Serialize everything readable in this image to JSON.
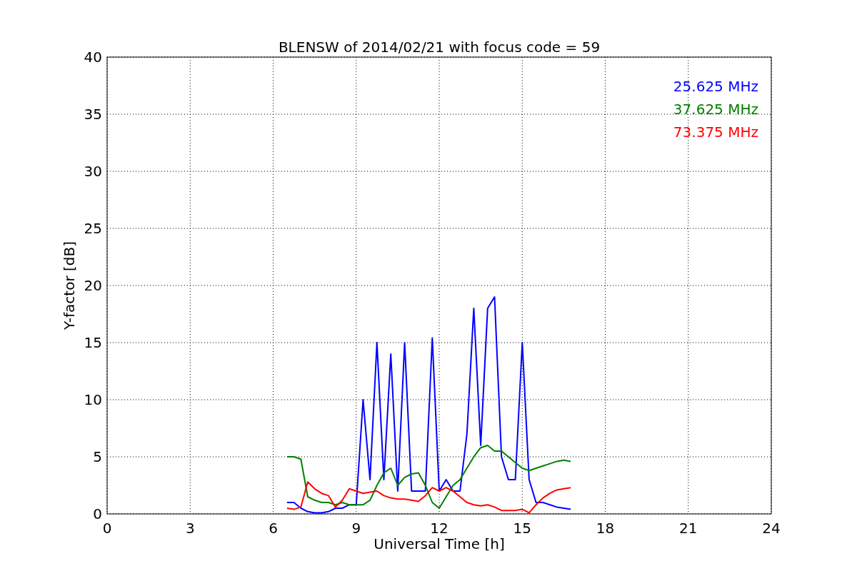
{
  "figure": {
    "chart_data": {
      "type": "line",
      "title": "BLENSW of 2014/02/21 with focus code = 59",
      "xlabel": "Universal Time [h]",
      "ylabel": "Y-factor [dB]",
      "x": [
        6.5,
        6.75,
        7,
        7.25,
        7.5,
        7.75,
        8,
        8.25,
        8.5,
        8.75,
        9,
        9.25,
        9.5,
        9.75,
        10,
        10.25,
        10.5,
        10.75,
        11,
        11.25,
        11.5,
        11.75,
        12,
        12.25,
        12.5,
        12.75,
        13,
        13.25,
        13.5,
        13.75,
        14,
        14.25,
        14.5,
        14.75,
        15,
        15.25,
        15.5,
        15.75,
        16,
        16.25,
        16.5,
        16.75
      ],
      "series": [
        {
          "name": "25.625 MHz",
          "color": "#0000ff",
          "values": [
            1,
            1,
            0.5,
            0.2,
            0.1,
            0.1,
            0.2,
            0.5,
            0.5,
            0.8,
            0.8,
            10,
            3,
            15,
            3,
            14,
            2,
            15,
            2,
            2,
            2,
            15.4,
            2,
            3,
            2,
            2,
            7,
            18,
            6,
            18,
            19,
            5,
            3,
            3,
            15,
            3,
            1,
            1,
            0.8,
            0.6,
            0.5,
            0.4
          ]
        },
        {
          "name": "37.625 MHz",
          "color": "#008000",
          "values": [
            5,
            5,
            4.8,
            1.5,
            1.2,
            1,
            1,
            0.8,
            1,
            0.8,
            0.8,
            0.8,
            1.2,
            2.5,
            3.6,
            4,
            2.5,
            3.2,
            3.5,
            3.6,
            2.5,
            1,
            0.5,
            1.5,
            2.5,
            3,
            4,
            5,
            5.8,
            6,
            5.5,
            5.5,
            5,
            4.5,
            4,
            3.8,
            4,
            4.2,
            4.4,
            4.6,
            4.7,
            4.6
          ]
        },
        {
          "name": "73.375 MHz",
          "color": "#ff0000",
          "values": [
            0.5,
            0.4,
            0.6,
            2.8,
            2.2,
            1.8,
            1.6,
            0.6,
            1.2,
            2.2,
            2,
            1.8,
            1.9,
            2,
            1.6,
            1.4,
            1.3,
            1.3,
            1.2,
            1.1,
            1.6,
            2.3,
            2,
            2.3,
            2,
            1.5,
            1,
            0.8,
            0.7,
            0.8,
            0.6,
            0.3,
            0.3,
            0.3,
            0.4,
            0.1,
            0.8,
            1.4,
            1.8,
            2.1,
            2.2,
            2.3
          ]
        }
      ],
      "grid": true,
      "xlim": [
        0,
        24
      ],
      "ylim": [
        0,
        40
      ],
      "xticks": [
        0,
        3,
        6,
        9,
        12,
        15,
        18,
        21,
        24
      ],
      "yticks": [
        0,
        5,
        10,
        15,
        20,
        25,
        30,
        35,
        40
      ]
    }
  }
}
